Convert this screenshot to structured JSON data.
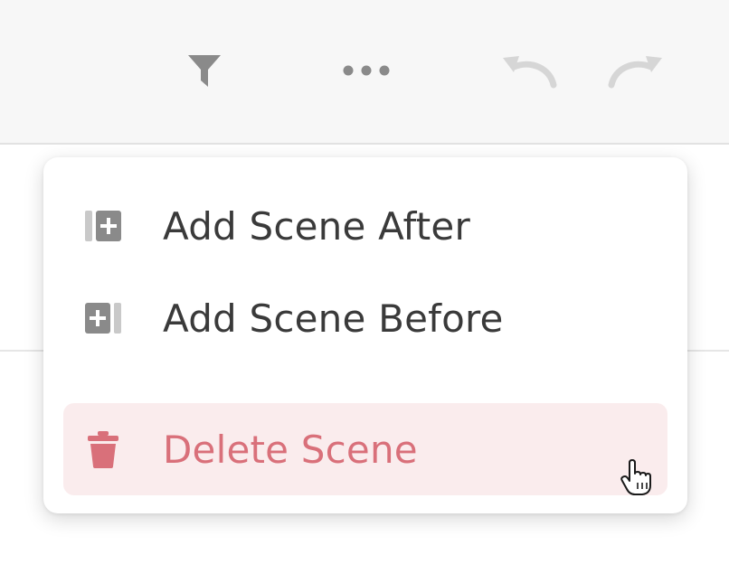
{
  "toolbar": {
    "icons": {
      "filter": "filter-icon",
      "more": "more-horizontal-icon",
      "undo": "undo-icon",
      "redo": "redo-icon"
    }
  },
  "menu": {
    "items": [
      {
        "label": "Add Scene After",
        "icon": "add-scene-after-icon"
      },
      {
        "label": "Add Scene Before",
        "icon": "add-scene-before-icon"
      },
      {
        "label": "Delete Scene",
        "icon": "trash-icon",
        "state": "hovered"
      }
    ]
  },
  "colors": {
    "toolbar_bg": "#f7f7f7",
    "icon_gray": "#8a8a8a",
    "icon_disabled": "#d6d6d6",
    "text": "#3a3a3a",
    "danger_text": "#d9707a",
    "danger_bg": "#faeced"
  }
}
